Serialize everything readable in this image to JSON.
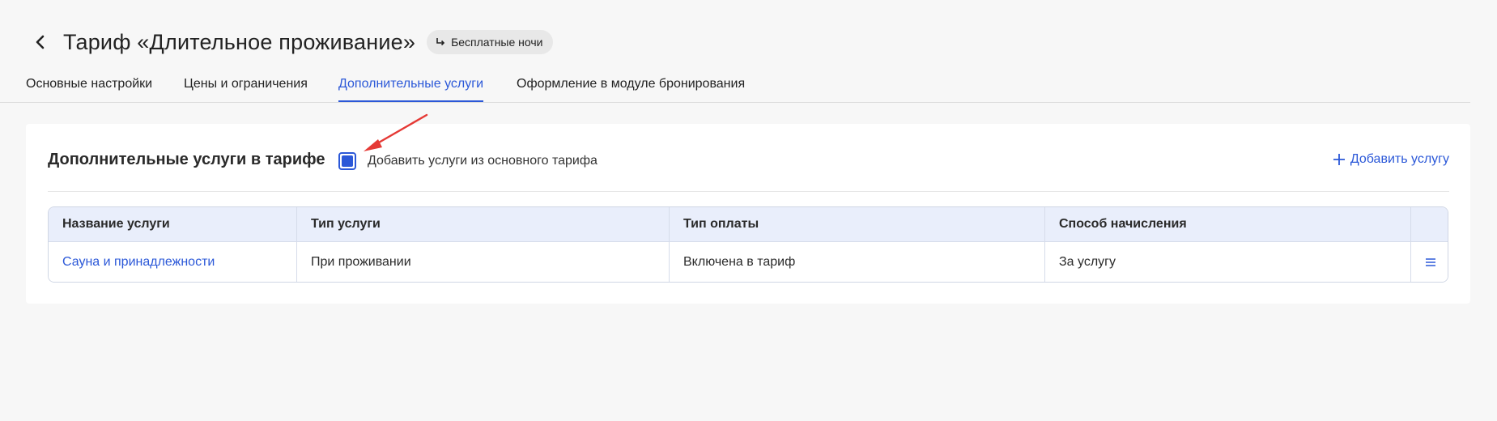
{
  "header": {
    "title": "Тариф «Длительное проживание»",
    "badge_label": "Бесплатные ночи"
  },
  "tabs": [
    {
      "label": "Основные настройки",
      "active": false
    },
    {
      "label": "Цены и ограничения",
      "active": false
    },
    {
      "label": "Дополнительные услуги",
      "active": true
    },
    {
      "label": "Оформление в модуле бронирования",
      "active": false
    }
  ],
  "section": {
    "title": "Дополнительные услуги в тарифе",
    "checkbox_label": "Добавить услуги из основного тарифа",
    "checkbox_checked": true,
    "add_button_label": "Добавить услугу"
  },
  "table": {
    "columns": [
      "Название услуги",
      "Тип услуги",
      "Тип оплаты",
      "Способ начисления"
    ],
    "rows": [
      {
        "name": "Сауна и принадлежности",
        "service_type": "При проживании",
        "payment_type": "Включена в тариф",
        "charge_method": "За услугу"
      }
    ]
  },
  "colors": {
    "accent": "#2b58d8",
    "annotation_arrow": "#e53935"
  }
}
